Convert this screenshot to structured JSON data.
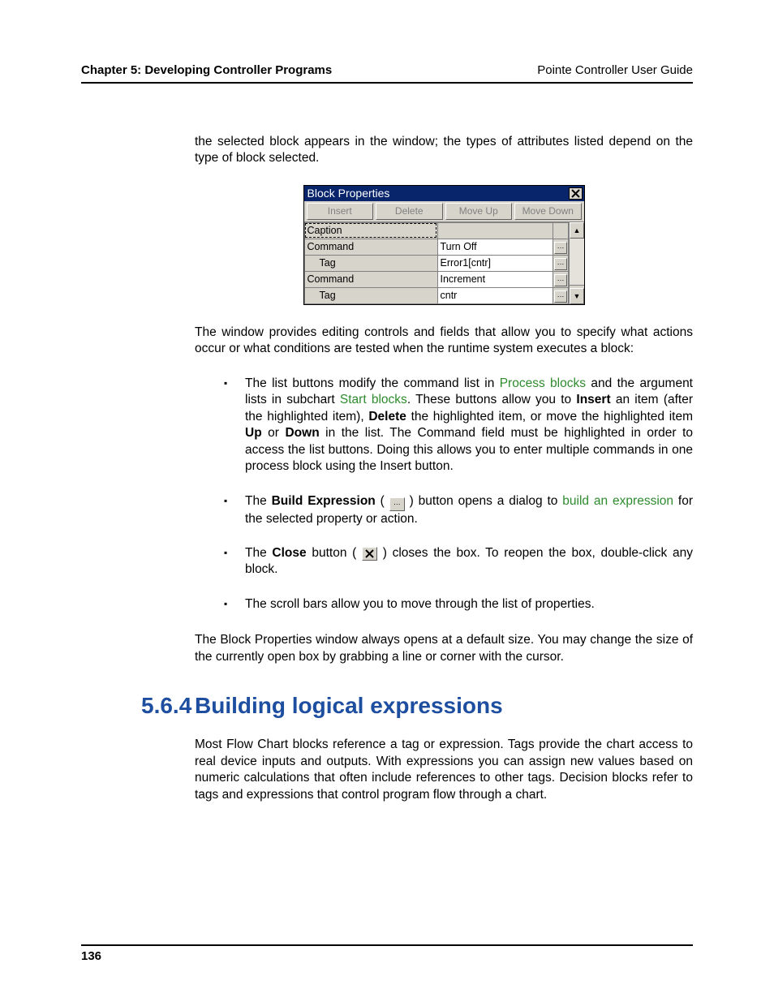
{
  "header": {
    "chapter": "Chapter 5: Developing Controller Programs",
    "guide": "Pointe Controller User Guide"
  },
  "intro": "the selected block appears in the window; the types of attributes listed depend on the type of block selected.",
  "dialog": {
    "title": "Block Properties",
    "buttons": {
      "insert": "Insert",
      "delete": "Delete",
      "moveup": "Move Up",
      "movedown": "Move Down"
    },
    "rows": [
      {
        "label": "Caption",
        "value": "",
        "btn": false,
        "indent": false,
        "selected": true,
        "white": false
      },
      {
        "label": "Command",
        "value": "Turn Off",
        "btn": true,
        "indent": false,
        "selected": false,
        "white": true
      },
      {
        "label": "Tag",
        "value": "Error1[cntr]",
        "btn": true,
        "indent": true,
        "selected": false,
        "white": true
      },
      {
        "label": "Command",
        "value": "Increment",
        "btn": true,
        "indent": false,
        "selected": false,
        "white": true
      },
      {
        "label": "Tag",
        "value": "cntr",
        "btn": true,
        "indent": true,
        "selected": false,
        "white": true
      }
    ]
  },
  "para_after_dialog": "The window provides editing controls and fields that allow you to specify what actions occur or what conditions are tested when the runtime system executes a block:",
  "bullets": {
    "b1": {
      "t1": "The list buttons modify the command list in ",
      "link1": "Process blocks",
      "t2": " and the argument lists in subchart ",
      "link2": "Start blocks",
      "t3": ". These buttons allow you to ",
      "bold1": "Insert",
      "t4": " an item (after the highlighted item), ",
      "bold2": "Delete",
      "t5": " the highlighted item, or move the highlighted item ",
      "bold3": "Up",
      "t6": " or ",
      "bold4": "Down",
      "t7": " in the list. The Command field must be highlighted in order to access the list buttons. Doing this allows you to enter multiple commands in one process block using the Insert button."
    },
    "b2": {
      "t1": "The ",
      "bold1": "Build Expression",
      "t2": " ( ",
      "t3": " ) button opens a dialog to ",
      "link1": "build an expression",
      "t4": " for the selected property or action."
    },
    "b3": {
      "t1": "The ",
      "bold1": "Close",
      "t2": " button ( ",
      "t3": " ) closes the box. To reopen the box, double-click any block."
    },
    "b4": "The scroll bars allow you to move through the list of properties."
  },
  "para_after_bullets": "The Block Properties window always opens at a default size. You may change the size of the currently open box by grabbing a line or corner with the cursor.",
  "section": {
    "number": "5.6.4",
    "title": "Building logical expressions"
  },
  "section_para": "Most Flow Chart blocks reference a tag or expression. Tags provide the chart access to real device inputs and outputs. With expressions you can assign new values based on numeric calculations that often include references to other tags. Decision blocks refer to tags and expressions that control program flow through a chart.",
  "page_number": "136"
}
